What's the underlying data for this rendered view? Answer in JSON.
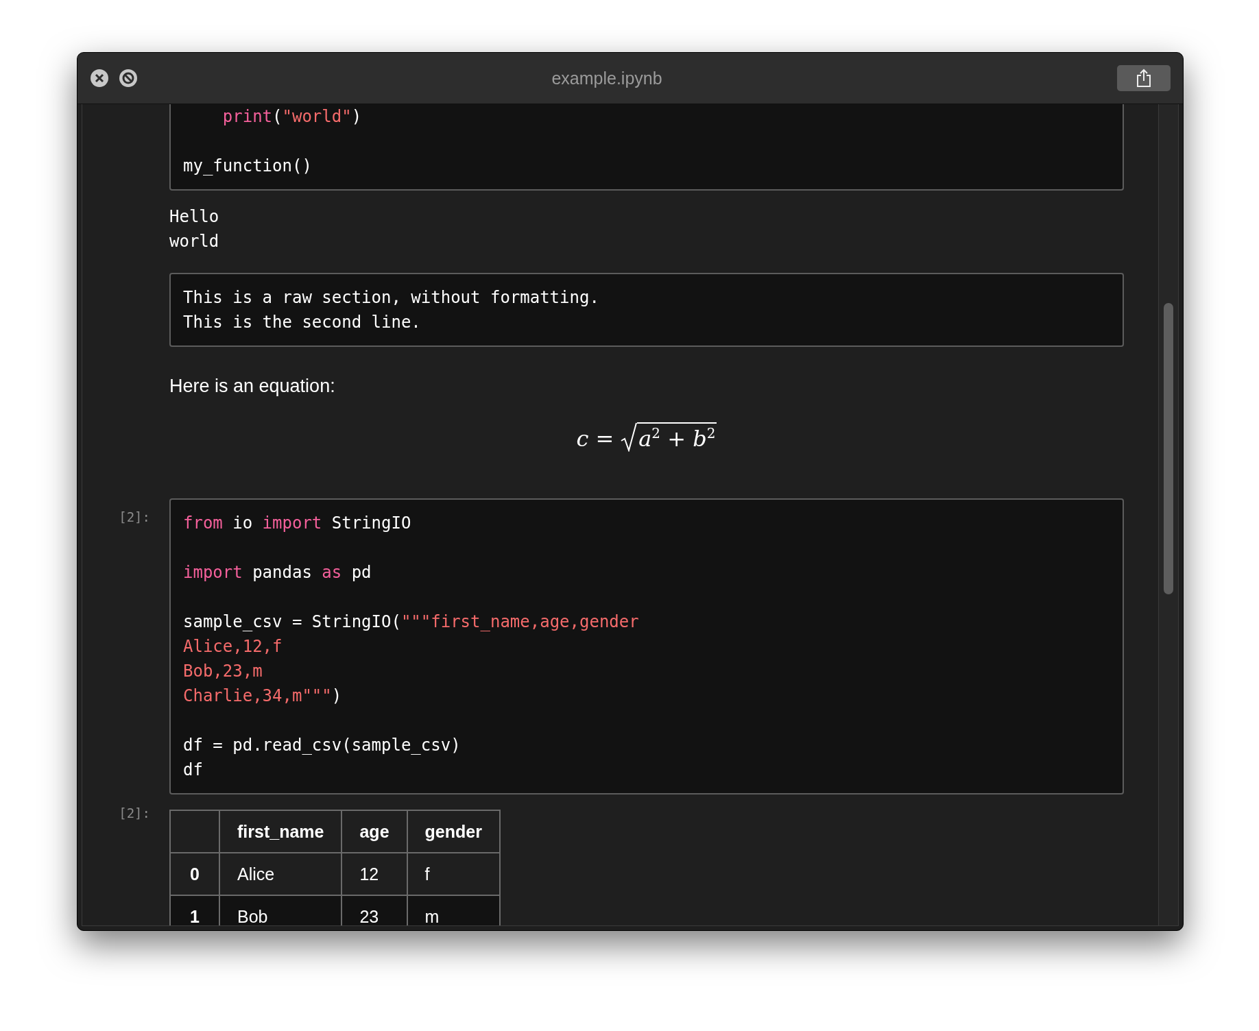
{
  "window": {
    "title": "example.ipynb"
  },
  "cells": [
    {
      "kind": "code",
      "paragraphs": [
        [
          [
            {
              "text": "    print",
              "kind": "keyword"
            },
            {
              "text": "("
            },
            {
              "text": "\"world\"",
              "kind": "string"
            },
            {
              "text": ")"
            }
          ]
        ],
        [
          [
            {
              "text": "my_function()"
            }
          ]
        ]
      ]
    },
    {
      "kind": "stream",
      "lines": [
        "Hello",
        "world"
      ]
    },
    {
      "kind": "raw",
      "lines": [
        "This is a raw section, without formatting.",
        "This is the second line."
      ]
    },
    {
      "kind": "markdown",
      "text": "Here is an equation:",
      "equation": {
        "lhs": "c",
        "op": "=",
        "radicand": "a$^{2}$ + b$^{2}$"
      }
    },
    {
      "kind": "code",
      "prompt": "[2]:",
      "paragraphs": [
        [
          [
            {
              "text": "from",
              "kind": "keyword"
            },
            {
              "text": " io "
            },
            {
              "text": "import",
              "kind": "keyword"
            },
            {
              "text": " StringIO"
            }
          ]
        ],
        [
          [
            {
              "text": "import",
              "kind": "keyword"
            },
            {
              "text": " pandas "
            },
            {
              "text": "as",
              "kind": "keyword"
            },
            {
              "text": " pd"
            }
          ]
        ],
        [
          [
            {
              "text": "sample_csv = StringIO("
            },
            {
              "text": "\"\"\"first_name,age,gender",
              "kind": "string"
            }
          ],
          [
            {
              "text": "Alice,12,f",
              "kind": "string"
            }
          ],
          [
            {
              "text": "Bob,23,m",
              "kind": "string"
            }
          ],
          [
            {
              "text": "Charlie,34,m\"\"\"",
              "kind": "string"
            },
            {
              "text": ")"
            }
          ]
        ],
        [
          [
            {
              "text": "df = pd.read_csv(sample_csv)"
            }
          ],
          [
            {
              "text": "df"
            }
          ]
        ]
      ]
    },
    {
      "kind": "table",
      "prompt": "[2]:",
      "columns": [
        "first_name",
        "age",
        "gender"
      ],
      "rows": [
        {
          "index": "0",
          "cells": [
            "Alice",
            "12",
            "f"
          ]
        },
        {
          "index": "1",
          "cells": [
            "Bob",
            "23",
            "m"
          ]
        }
      ]
    }
  ]
}
